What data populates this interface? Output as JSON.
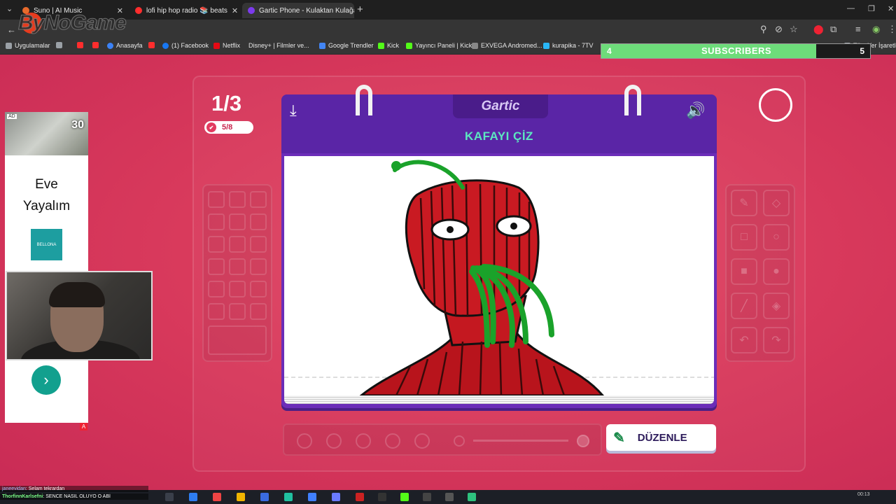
{
  "browser": {
    "tabs": [
      {
        "label": "Suno | AI Music",
        "color": "#e86a2c",
        "active": false
      },
      {
        "label": "lofi hip hop radio 📚 beats",
        "color": "#ff2d2d",
        "active": false
      },
      {
        "label": "Gartic Phone - Kulaktan Kulağa",
        "color": "#7c3aed",
        "active": true
      }
    ],
    "window_controls": [
      "—",
      "❐",
      "✕"
    ],
    "toolbar_icons": [
      "⚲",
      "⊘",
      "☆",
      "⬤",
      "⧉",
      "≡",
      "◉",
      "⋮"
    ],
    "bookmarks": [
      {
        "label": "Uygulamalar",
        "color": "#9aa0a6"
      },
      {
        "label": "",
        "color": "#ff2d2d"
      },
      {
        "label": "",
        "color": "#ff2d2d"
      },
      {
        "label": "Anasayfa",
        "color": "#3b82f6"
      },
      {
        "label": "",
        "color": "#ff2d2d"
      },
      {
        "label": "(1) Facebook",
        "color": "#1877f2"
      },
      {
        "label": "Netflix",
        "color": "#e50914"
      },
      {
        "label": "Disney+ | Filmler ve...",
        "color": "#113ccf"
      },
      {
        "label": "Google Trendler",
        "color": "#4285f4"
      },
      {
        "label": "Kick",
        "color": "#53fc18"
      },
      {
        "label": "Yayıncı Paneli | Kick",
        "color": "#53fc18"
      },
      {
        "label": "EXVEGA Andromed...",
        "color": "#888888"
      },
      {
        "label": "kurapika - 7TV",
        "color": "#29b6f6"
      },
      {
        "label": "Tüm Yer İşaretleri",
        "color": "#9aa0a6"
      }
    ],
    "watermark": "ByNoGame"
  },
  "game": {
    "round": "1/3",
    "likes": "5/8",
    "logo": "Gartic",
    "phrase": "KAFAYI ÇİZ",
    "download_icon": "download-icon",
    "sound_icon": "sound-icon",
    "edit_label": "DÜZENLE",
    "tool_icons": [
      "✎",
      "◇",
      "□",
      "○",
      "■",
      "●",
      "╱",
      "◈",
      "↶",
      "↷"
    ]
  },
  "ad": {
    "tag": "AD",
    "badge": "30",
    "title_line1": "Eve",
    "title_line2": "Yayalım",
    "brand": "BELLONA",
    "footer": "A"
  },
  "overlay": {
    "subscribers_label": "SUBSCRIBERS",
    "subscribers_current": "4",
    "subscribers_goal": "5",
    "subscribers_progress": 0.8
  },
  "chat": [
    {
      "user": "janeevidan",
      "message": "Selam tekrardan"
    },
    {
      "user": "ThorfinnKarlsefni",
      "message": "SENCE NASIL OLUYO O ABİ"
    }
  ],
  "taskbar": {
    "time": "00:13"
  },
  "colors": {
    "page_bg": "#d93a5c",
    "card_purple": "#6b2db8",
    "phrase_green": "#5ce8c0"
  }
}
